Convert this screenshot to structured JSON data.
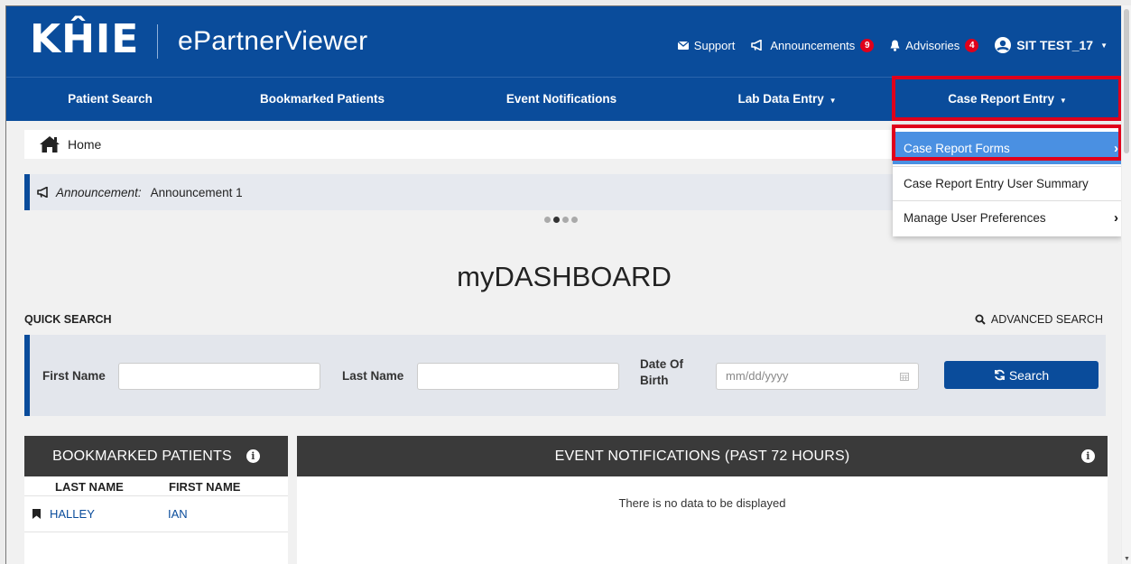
{
  "header": {
    "logo_text": "KĤIE",
    "app_title": "ePartnerViewer",
    "support_label": "Support",
    "announcements_label": "Announcements",
    "announcements_count": "9",
    "advisories_label": "Advisories",
    "advisories_count": "4",
    "user_name": "SIT TEST_17",
    "brand_color": "#0a4c9b",
    "badge_color": "#e0001b"
  },
  "nav": {
    "items": [
      {
        "label": "Patient Search"
      },
      {
        "label": "Bookmarked Patients"
      },
      {
        "label": "Event Notifications"
      },
      {
        "label": "Lab Data Entry"
      },
      {
        "label": "Case Report Entry"
      }
    ]
  },
  "dropdown": {
    "items": [
      {
        "label": "Case Report Forms",
        "active": true
      },
      {
        "label": "Case Report Entry User Summary"
      },
      {
        "label": "Manage User Preferences"
      }
    ]
  },
  "breadcrumb": {
    "home_label": "Home"
  },
  "announcement": {
    "label": "Announcement:",
    "text": "Announcement 1",
    "carousel_active_index": 2,
    "carousel_count": 4
  },
  "dashboard": {
    "title": "myDASHBOARD",
    "quick_search_label": "QUICK SEARCH",
    "advanced_search_label": "ADVANCED SEARCH"
  },
  "search_form": {
    "first_name_label": "First Name",
    "first_name_value": "",
    "last_name_label": "Last Name",
    "last_name_value": "",
    "dob_label_line1": "Date Of",
    "dob_label_line2": "Birth",
    "dob_placeholder": "mm/dd/yyyy",
    "search_button_label": "Search"
  },
  "bookmarked": {
    "title": "BOOKMARKED PATIENTS",
    "columns": [
      "LAST NAME",
      "FIRST NAME"
    ],
    "rows": [
      {
        "last": "HALLEY",
        "first": "IAN"
      }
    ]
  },
  "events": {
    "title": "EVENT NOTIFICATIONS (PAST 72 HOURS)",
    "empty_text": "There is no data to be displayed"
  }
}
